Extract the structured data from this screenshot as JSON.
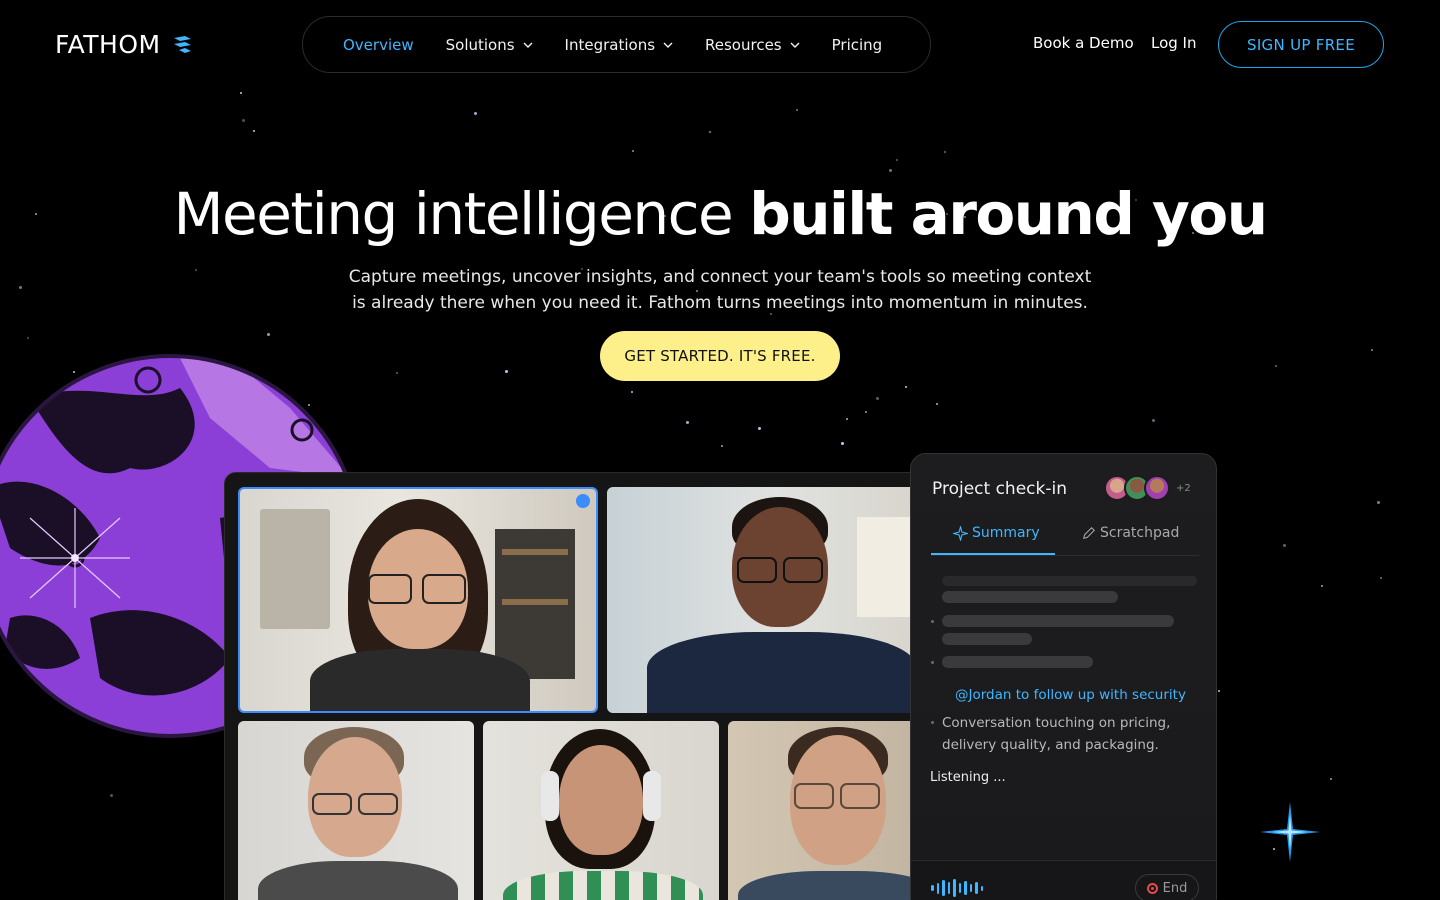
{
  "header": {
    "logo_text": "FATHOM",
    "nav": [
      {
        "label": "Overview",
        "active": true,
        "has_dropdown": false
      },
      {
        "label": "Solutions",
        "active": false,
        "has_dropdown": true
      },
      {
        "label": "Integrations",
        "active": false,
        "has_dropdown": true
      },
      {
        "label": "Resources",
        "active": false,
        "has_dropdown": true
      },
      {
        "label": "Pricing",
        "active": false,
        "has_dropdown": false
      }
    ],
    "book_demo": "Book a Demo",
    "login": "Log In",
    "signup": "SIGN UP FREE"
  },
  "hero": {
    "title_light": "Meeting intelligence",
    "title_bold": "built around you",
    "subtitle_line1": "Capture meetings, uncover insights, and connect your team's tools so meeting context",
    "subtitle_line2": "is already there when you need it. Fathom turns meetings into momentum in minutes.",
    "cta": "GET STARTED. IT'S FREE."
  },
  "meeting_panel": {
    "title": "Project check-in",
    "avatars_extra": "+2",
    "tabs": [
      {
        "label": "Summary",
        "active": true,
        "icon": "sparkle-icon"
      },
      {
        "label": "Scratchpad",
        "active": false,
        "icon": "pencil-icon"
      }
    ],
    "mention": "@Jordan to follow up with security",
    "note": "Conversation touching on pricing, delivery quality, and packaging.",
    "status": "Listening ...",
    "end_label": "End"
  },
  "colors": {
    "accent_blue": "#3fb6ff",
    "cta_yellow": "#fdf08a",
    "moon_purple": "#8b3fd6",
    "background": "#000000"
  }
}
